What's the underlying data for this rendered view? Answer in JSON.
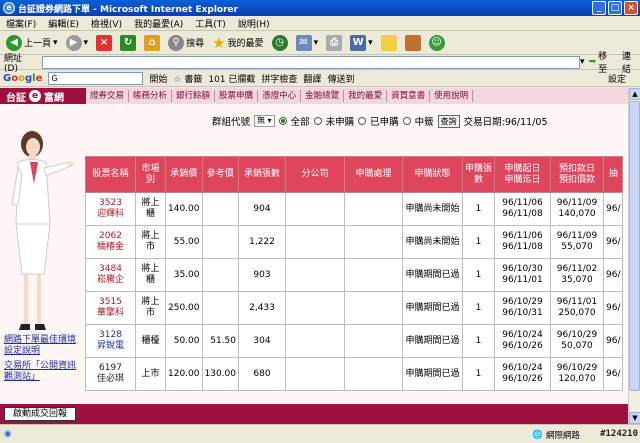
{
  "window": {
    "title": "台証證券網路下單 - Microsoft Internet Explorer",
    "controls": [
      "_",
      "□",
      "×"
    ]
  },
  "menu": [
    "檔案(F)",
    "編輯(E)",
    "檢視(V)",
    "我的最愛(A)",
    "工具(T)",
    "說明(H)"
  ],
  "toolbar": {
    "back": "上一頁",
    "search": "搜尋",
    "favorites": "我的最愛"
  },
  "address": {
    "label": "網址(D)",
    "value": "",
    "go": "移至",
    "links": "連結"
  },
  "google": {
    "logo": "Google",
    "search_prefix": "G",
    "start": "開始",
    "bookmarks": "書籤",
    "blocked": "101 已攔截",
    "spell": "拼字檢查",
    "translate": "翻譯",
    "send": "傳送到",
    "settings": "設定"
  },
  "site": {
    "brand_prefix": "台証",
    "brand_e": "e",
    "brand_suffix": "富網",
    "nav": [
      "證券交易",
      "帳務分析",
      "銀行餘額",
      "股票申購",
      "憑證中心",
      "金融總覽",
      "我的最愛",
      "資買意書",
      "使用說明"
    ]
  },
  "sidebar": {
    "link1": "網路下單最佳環境設定說明",
    "link2": "交易所「公開資訊觀測站」"
  },
  "filters": {
    "group_label": "群組代號",
    "group_value": "無",
    "opt_all": "全部",
    "opt_not": "未申購",
    "opt_done": "已申購",
    "opt_won": "中籤",
    "query": "查詢",
    "trade_date": "交易日期:96/11/05"
  },
  "table": {
    "headers": [
      "股票名稱",
      "市場別",
      "承銷價",
      "參考價",
      "承銷張數",
      "分公司",
      "申購處理",
      "申購狀態",
      "申購張數",
      "申購起日\n申購迄日",
      "預扣款日\n預扣價款",
      "抽"
    ],
    "rows": [
      {
        "code": "3523",
        "name": "迎輝科",
        "market": "將上櫃",
        "price": "140.00",
        "ref": "",
        "lots": "904",
        "status": "申購尚未開始",
        "qty": "1",
        "start": "96/11/06",
        "end": "96/11/08",
        "deduct_date": "96/11/09",
        "deduct_amt": "140,070",
        "draw": "96/",
        "color": "red"
      },
      {
        "code": "2062",
        "name": "橋椿金",
        "market": "將上市",
        "price": "55.00",
        "ref": "",
        "lots": "1,222",
        "status": "申購尚未開始",
        "qty": "1",
        "start": "96/11/06",
        "end": "96/11/08",
        "deduct_date": "96/11/09",
        "deduct_amt": "55,070",
        "draw": "96/",
        "color": "red"
      },
      {
        "code": "3484",
        "name": "崧騰企",
        "market": "將上櫃",
        "price": "35.00",
        "ref": "",
        "lots": "903",
        "status": "申購期間已過",
        "qty": "1",
        "start": "96/10/30",
        "end": "96/11/01",
        "deduct_date": "96/11/02",
        "deduct_amt": "35,070",
        "draw": "96/",
        "color": "red"
      },
      {
        "code": "3515",
        "name": "華擎科",
        "market": "將上市",
        "price": "250.00",
        "ref": "",
        "lots": "2,433",
        "status": "申購期間已過",
        "qty": "1",
        "start": "96/10/29",
        "end": "96/10/31",
        "deduct_date": "96/11/01",
        "deduct_amt": "250,070",
        "draw": "96/",
        "color": "red"
      },
      {
        "code": "3128",
        "name": "昇銳電",
        "market": "櫃檯",
        "price": "50.00",
        "ref": "51.50",
        "lots": "304",
        "status": "申購期間已過",
        "qty": "1",
        "start": "96/10/24",
        "end": "96/10/26",
        "deduct_date": "96/10/29",
        "deduct_amt": "50,070",
        "draw": "96/",
        "color": "blue"
      },
      {
        "code": "6197",
        "name": "佳必琪",
        "market": "上市",
        "price": "120.00",
        "ref": "130.00",
        "lots": "680",
        "status": "申購期間已過",
        "qty": "1",
        "start": "96/10/24",
        "end": "96/10/26",
        "deduct_date": "96/10/29",
        "deduct_amt": "120,070",
        "draw": "96/",
        "color": "black"
      }
    ]
  },
  "bottom_tab": "啟動成交回報",
  "status": {
    "zone": "網際網路",
    "watermark": "#124210"
  }
}
